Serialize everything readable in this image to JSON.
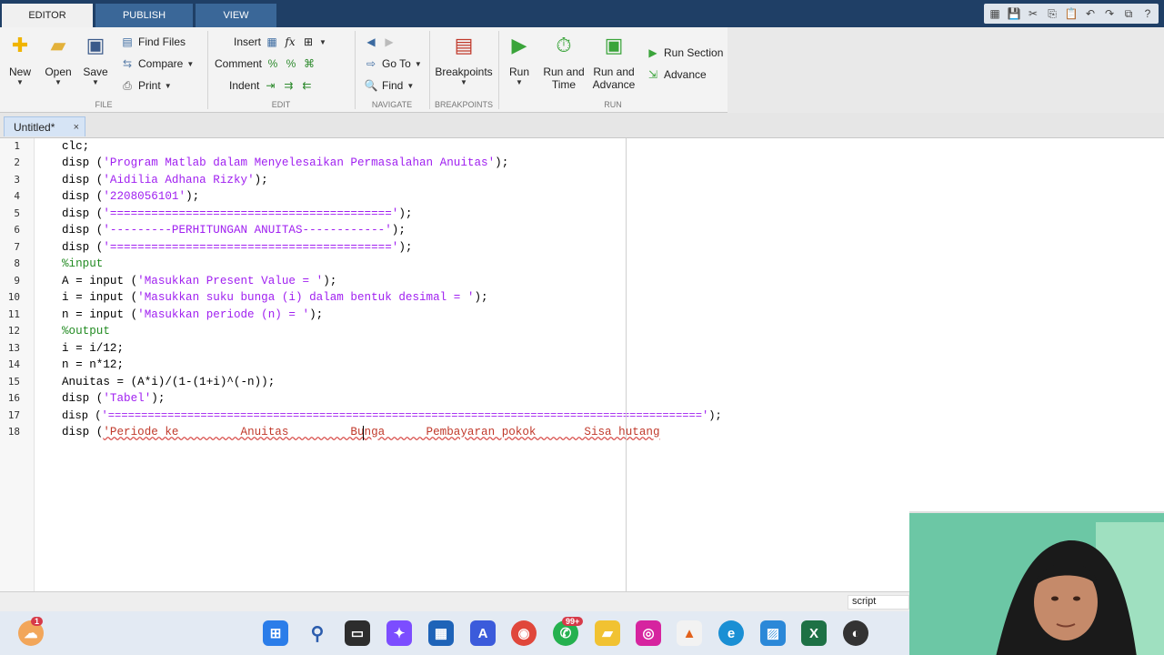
{
  "ribbon_tabs": [
    "EDITOR",
    "PUBLISH",
    "VIEW"
  ],
  "file_group": {
    "new_label": "New",
    "open_label": "Open",
    "save_label": "Save",
    "find_files_label": "Find Files",
    "compare_label": "Compare",
    "print_label": "Print",
    "group_label": "FILE"
  },
  "edit_group": {
    "insert_label": "Insert",
    "comment_label": "Comment",
    "indent_label": "Indent",
    "group_label": "EDIT"
  },
  "navigate_group": {
    "goto_label": "Go To",
    "find_label": "Find",
    "group_label": "NAVIGATE"
  },
  "breakpoints_group": {
    "breakpoints_label": "Breakpoints",
    "group_label": "BREAKPOINTS"
  },
  "run_group": {
    "run_label": "Run",
    "run_time_label_1": "Run and",
    "run_time_label_2": "Time",
    "run_advance_label_1": "Run and",
    "run_advance_label_2": "Advance",
    "run_section_label": "Run Section",
    "advance_label": "Advance",
    "group_label": "RUN"
  },
  "document_tab": {
    "title": "Untitled*",
    "close": "×"
  },
  "code": {
    "line_numbers": [
      "1",
      "2",
      "3",
      "4",
      "5",
      "6",
      "7",
      "8",
      "9",
      "10",
      "11",
      "12",
      "13",
      "14",
      "15",
      "16",
      "17",
      "18"
    ],
    "l1": "clc;",
    "l2a": "disp (",
    "l2b": "'Program Matlab dalam Menyelesaikan Permasalahan Anuitas'",
    "l2c": ");",
    "l3a": "disp (",
    "l3b": "'Aidilia Adhana Rizky'",
    "l3c": ");",
    "l4a": "disp (",
    "l4b": "'2208056101'",
    "l4c": ");",
    "l5a": "disp (",
    "l5b": "'========================================='",
    "l5c": ");",
    "l6a": "disp (",
    "l6b": "'---------PERHITUNGAN ANUITAS------------'",
    "l6c": ");",
    "l7a": "disp (",
    "l7b": "'========================================='",
    "l7c": ");",
    "l8": "%input",
    "l9a": "A = input (",
    "l9b": "'Masukkan Present Value = '",
    "l9c": ");",
    "l10a": "i = input (",
    "l10b": "'Masukkan suku bunga (i) dalam bentuk desimal = '",
    "l10c": ");",
    "l11a": "n = input (",
    "l11b": "'Masukkan periode (n) = '",
    "l11c": ");",
    "l12": "%output",
    "l13": "i = i/12;",
    "l14": "n = n*12;",
    "l15": "Anuitas = (A*i)/(1-(1+i)^(-n));",
    "l16a": "disp (",
    "l16b": "'Tabel'",
    "l16c": ");",
    "l17a": "disp (",
    "l17b": "'=========================================================================================='",
    "l17c": ");",
    "l18a": "disp (",
    "l18b": "'Periode ke         Anuitas         Bunga      Pembayaran pokok       Sisa hutang"
  },
  "status": {
    "file_type": "script"
  },
  "taskbar": {
    "notification_badge": "1",
    "whatsapp_badge": "99+"
  },
  "colors": {
    "string": "#a020f0",
    "comment": "#228b22",
    "error": "#c0392b",
    "ribbon_header": "#1f3f66"
  }
}
